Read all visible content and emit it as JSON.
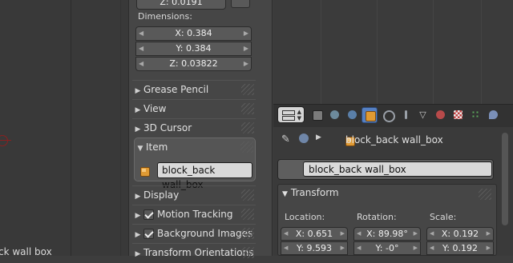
{
  "viewport": {
    "object_label": "ck wall box"
  },
  "npanel": {
    "top_field": "Z: 0.0191",
    "dimensions": {
      "label": "Dimensions:",
      "x": "X: 0.384",
      "y": "Y: 0.384",
      "z": "Z: 0.03822"
    },
    "sections": {
      "grease_pencil": "Grease Pencil",
      "view": "View",
      "cursor": "3D Cursor",
      "item": "Item",
      "display": "Display",
      "motion_tracking": "Motion Tracking",
      "background_images": "Background Images",
      "transform_orientations": "Transform Orientations"
    },
    "item_name": "block_back wall_box"
  },
  "properties": {
    "tabs": [
      "render-icon",
      "render-layers-icon",
      "scene-icon",
      "world-icon",
      "object-icon",
      "constraints-icon",
      "modifiers-icon",
      "data-icon",
      "material-icon",
      "texture-icon",
      "particles-icon",
      "physics-icon"
    ],
    "active_tab": "object-icon",
    "breadcrumb": "block_back wall_box",
    "object_name": "block_back wall_box",
    "transform": {
      "title": "Transform",
      "location_label": "Location:",
      "rotation_label": "Rotation:",
      "scale_label": "Scale:",
      "location_x": "X: 0.651",
      "location_y": "Y: 9.593",
      "rotation_x": "X: 89.98°",
      "rotation_y": "Y: -0°",
      "scale_x": "X: 0.192",
      "scale_y": "Y: 0.192"
    }
  },
  "colors": {
    "active_tab": "#5680c2",
    "object_orange": "#e09a33",
    "panel_bg": "#464646"
  }
}
